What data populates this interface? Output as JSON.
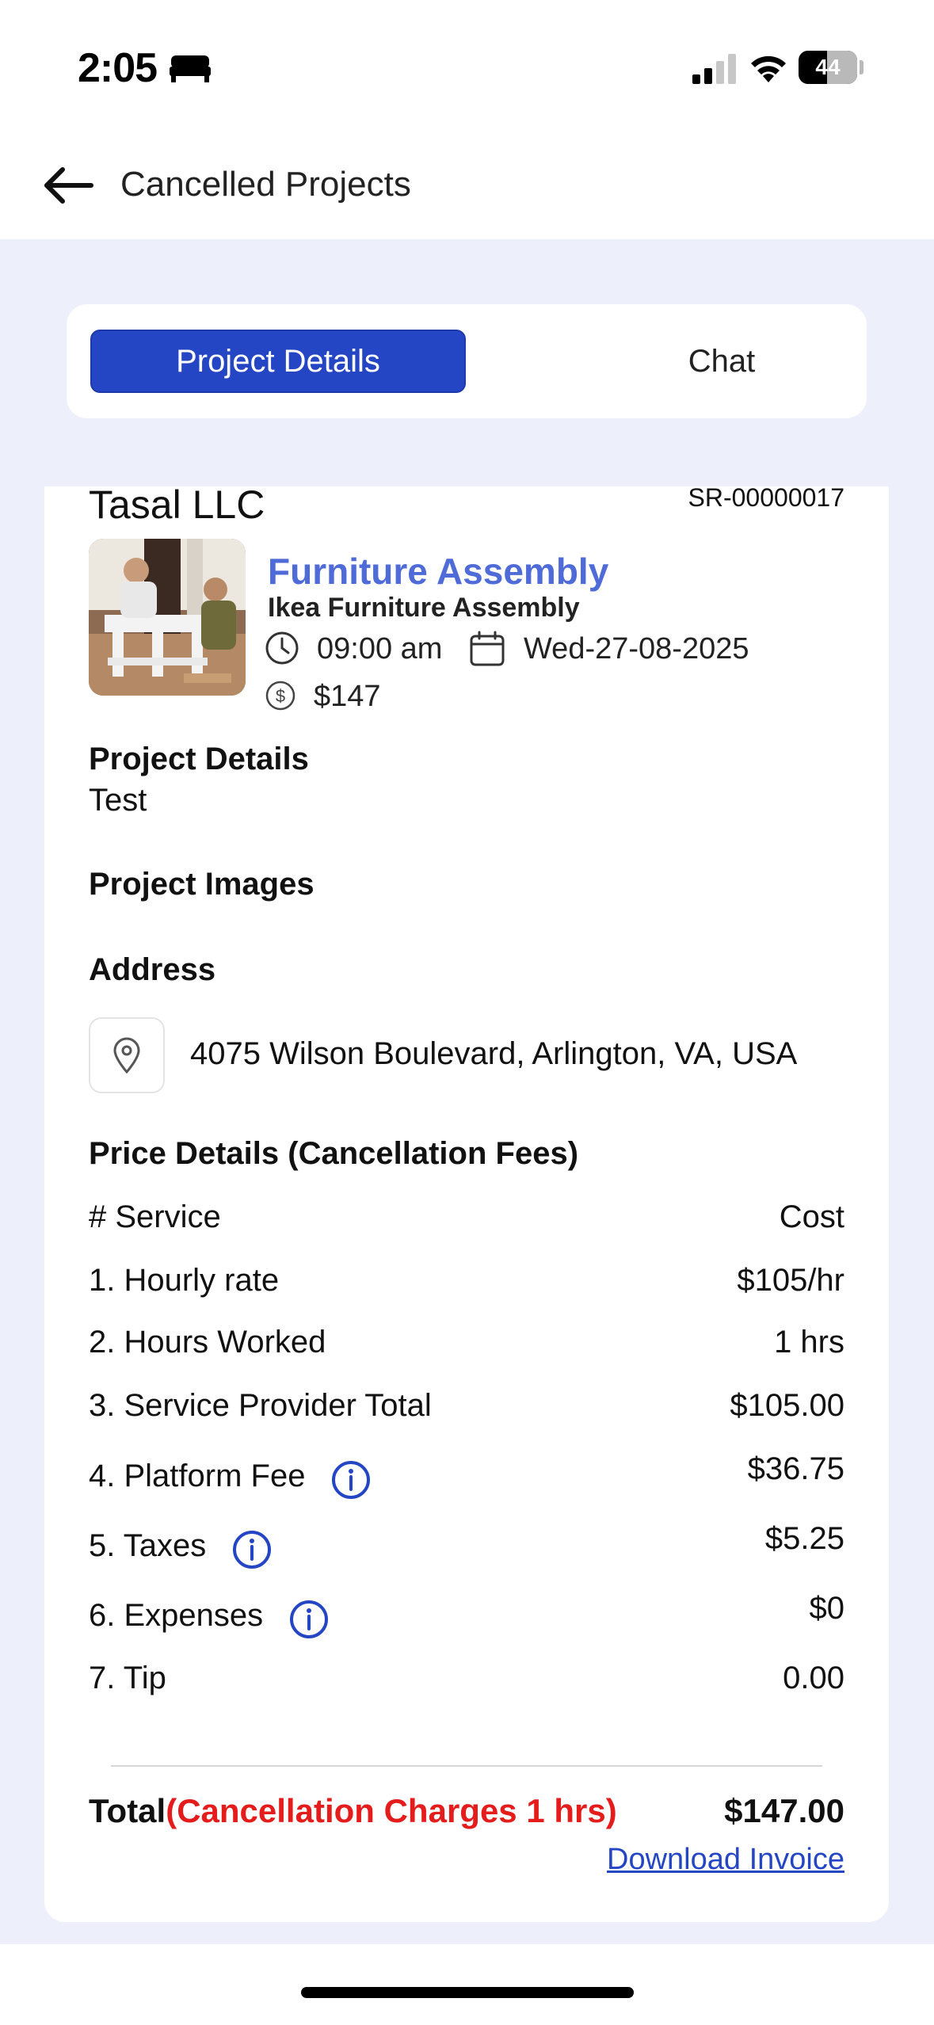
{
  "status_bar": {
    "time": "2:05",
    "battery": "44"
  },
  "header": {
    "title": "Cancelled Projects"
  },
  "tabs": [
    {
      "label": "Project Details",
      "active": true
    },
    {
      "label": "Chat",
      "active": false
    }
  ],
  "project": {
    "provider": "Tasal LLC",
    "sr_number": "SR-00000017",
    "service_title": "Furniture Assembly",
    "service_subtitle": "Ikea Furniture Assembly",
    "time": "09:00 am",
    "date": "Wed-27-08-2025",
    "price": "$147"
  },
  "details": {
    "project_details_title": "Project Details",
    "project_details_text": "Test",
    "project_images_title": "Project Images",
    "address_title": "Address",
    "address": "4075 Wilson Boulevard, Arlington, VA, USA"
  },
  "price_details": {
    "title": "Price Details (Cancellation Fees)",
    "header_left": "# Service",
    "header_right": "Cost",
    "rows": [
      {
        "label": "1. Hourly rate",
        "value": "$105/hr",
        "info": false
      },
      {
        "label": "2. Hours Worked",
        "value": "1 hrs",
        "info": false
      },
      {
        "label": "3. Service Provider Total",
        "value": "$105.00",
        "info": false
      },
      {
        "label": "4. Platform Fee",
        "value": "$36.75",
        "info": true
      },
      {
        "label": "5. Taxes",
        "value": "$5.25",
        "info": true
      },
      {
        "label": "6. Expenses",
        "value": "$0",
        "info": true
      },
      {
        "label": "7. Tip",
        "value": "0.00",
        "info": false
      }
    ],
    "total_label": "Total",
    "total_note": "(Cancellation Charges 1 hrs)",
    "total_value": "$147.00",
    "download_label": "Download Invoice"
  },
  "colors": {
    "accent": "#2546c4",
    "service_title": "#4f6bd8",
    "cancellation": "#e51c1c",
    "background": "#edf0fb"
  },
  "icons": [
    "bed-icon",
    "signal-icon",
    "wifi-icon",
    "back-arrow-icon",
    "clock-icon",
    "calendar-icon",
    "dollar-icon",
    "location-pin-icon",
    "info-icon"
  ]
}
